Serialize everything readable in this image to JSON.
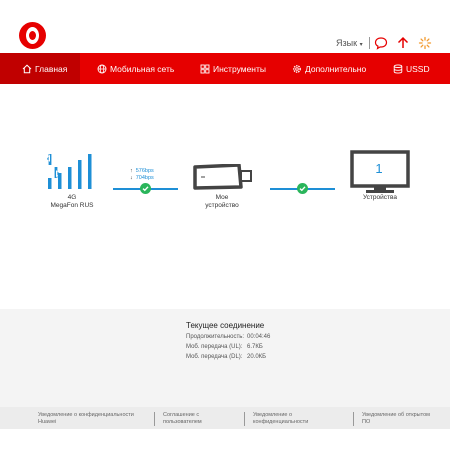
{
  "header": {
    "language_label": "Язык",
    "language_caret": "▾",
    "icons": [
      "message-icon",
      "upload-arrow-icon",
      "loading-spinner-icon"
    ]
  },
  "nav": {
    "items": [
      {
        "label": "Главная",
        "icon": "home-icon",
        "active": true
      },
      {
        "label": "Мобильная сеть",
        "icon": "globe-icon",
        "active": false
      },
      {
        "label": "Инструменты",
        "icon": "tools-icon",
        "active": false
      },
      {
        "label": "Дополнительно",
        "icon": "gear-icon",
        "active": false
      },
      {
        "label": "USSD",
        "icon": "database-icon",
        "active": false
      }
    ]
  },
  "diagram": {
    "network_type": "4G",
    "operator": "MegaFon RUS",
    "upload_speed": "576bps",
    "download_speed": "704bps",
    "device_label_line1": "Мое",
    "device_label_line2": "устройство",
    "connected_devices_count": "1",
    "connected_devices_label": "Устройства"
  },
  "connection": {
    "title": "Текущее соединение",
    "duration_label": "Продолжительность:",
    "duration_value": "00:04:46",
    "upload_label": "Моб. передача (UL):",
    "upload_value": "6.7КБ",
    "download_label": "Моб. передача (DL):",
    "download_value": "20.0КБ"
  },
  "footer": {
    "links": [
      {
        "line1": "Уведомление о конфиденциальности",
        "line2": "Huawei"
      },
      {
        "line1": "Соглашение с",
        "line2": "пользователем"
      },
      {
        "line1": "Уведомление о",
        "line2": "конфиденциальности"
      },
      {
        "line1": "Уведомление об открытом",
        "line2": "ПО"
      }
    ]
  },
  "colors": {
    "brand_red": "#e60000",
    "active_nav": "#c00000",
    "accent_blue": "#1e8fd6",
    "status_green": "#2ab55b"
  }
}
